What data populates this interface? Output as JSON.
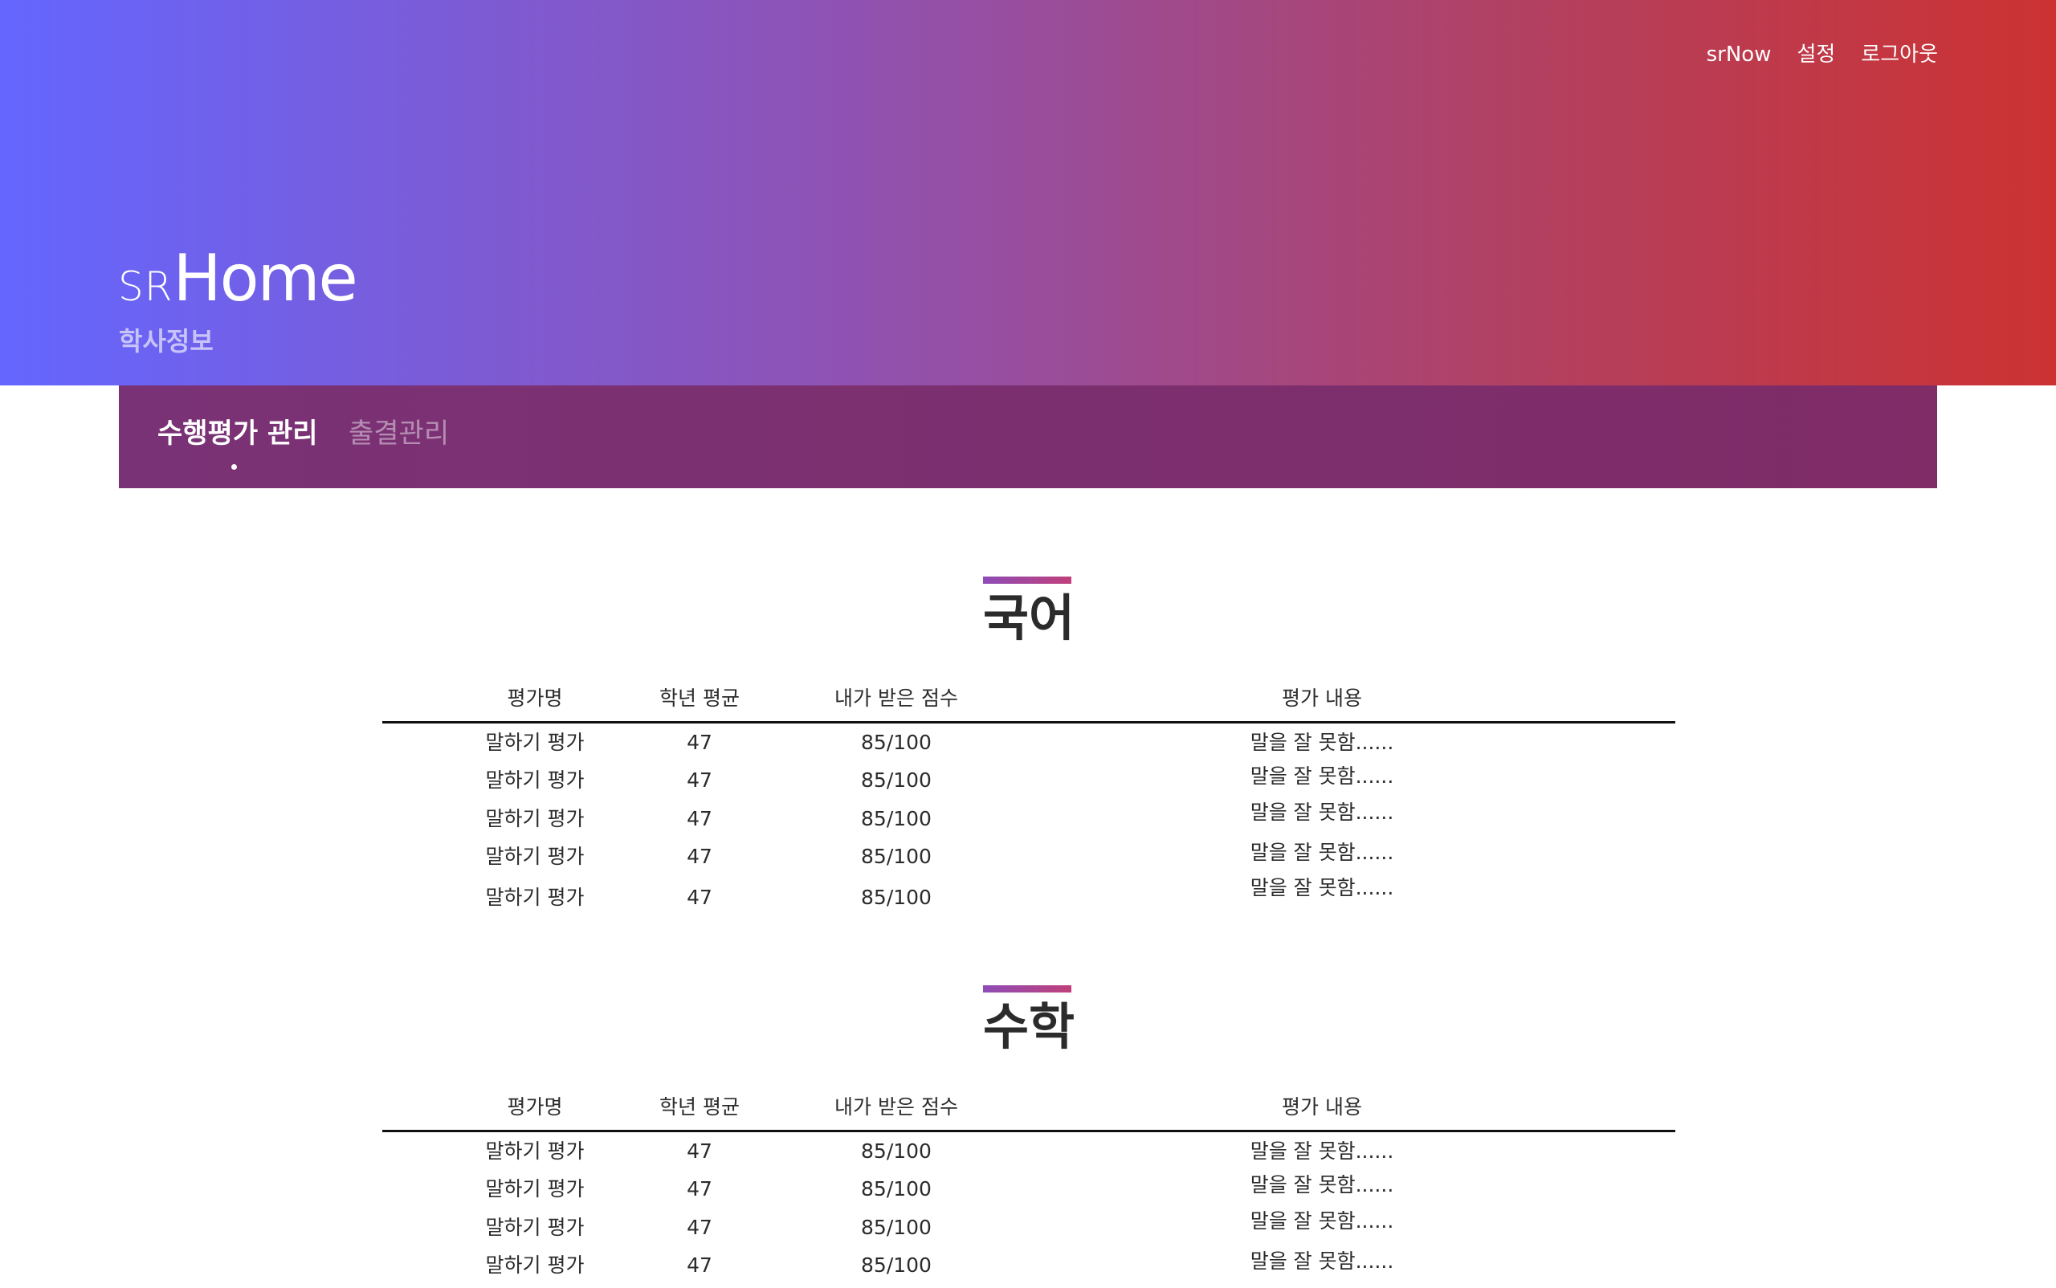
{
  "header": {
    "nav": [
      "srNow",
      "설정",
      "로그아웃"
    ],
    "brand_small": "SR",
    "brand_big": "Home",
    "subtitle": "학사정보"
  },
  "tabs": [
    "수행평가 관리",
    "출결관리"
  ],
  "columns": [
    "평가명",
    "학년 평균",
    "내가 받은 점수",
    "평가 내용"
  ],
  "sections": [
    {
      "title": "국어",
      "rows": [
        [
          "말하기 평가",
          "47",
          "85/100",
          "말을 잘 못함......"
        ],
        [
          "말하기 평가",
          "47",
          "85/100",
          "말을 잘 못함......"
        ],
        [
          "말하기 평가",
          "47",
          "85/100",
          "말을 잘 못함......"
        ],
        [
          "말하기 평가",
          "47",
          "85/100",
          "말을 잘 못함......"
        ],
        [
          "말하기 평가",
          "47",
          "85/100",
          "말을 잘 못함......"
        ]
      ]
    },
    {
      "title": "수학",
      "rows": [
        [
          "말하기 평가",
          "47",
          "85/100",
          "말을 잘 못함......"
        ],
        [
          "말하기 평가",
          "47",
          "85/100",
          "말을 잘 못함......"
        ],
        [
          "말하기 평가",
          "47",
          "85/100",
          "말을 잘 못함......"
        ],
        [
          "말하기 평가",
          "47",
          "85/100",
          "말을 잘 못함......"
        ]
      ]
    }
  ],
  "colors": {
    "gradient_start": "#6466ff",
    "gradient_end": "#cc3232",
    "tabbar": "#7c2f6f"
  }
}
